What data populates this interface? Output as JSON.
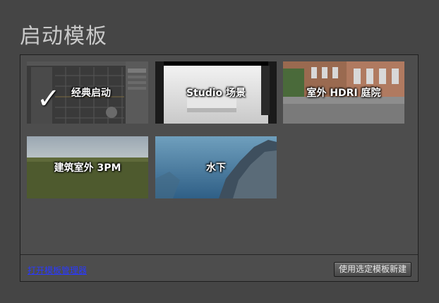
{
  "window": {
    "title": "启动模板"
  },
  "templates": [
    {
      "label": "经典启动",
      "selected": true,
      "check_icon": "✓"
    },
    {
      "label": "Studio 场景",
      "selected": false
    },
    {
      "label": "室外 HDRI 庭院",
      "selected": false
    },
    {
      "label": "建筑室外 3PM",
      "selected": false
    },
    {
      "label": "水下",
      "selected": false
    }
  ],
  "footer": {
    "open_manager_link": "打开模板管理器",
    "create_button": "使用选定模板新建"
  }
}
